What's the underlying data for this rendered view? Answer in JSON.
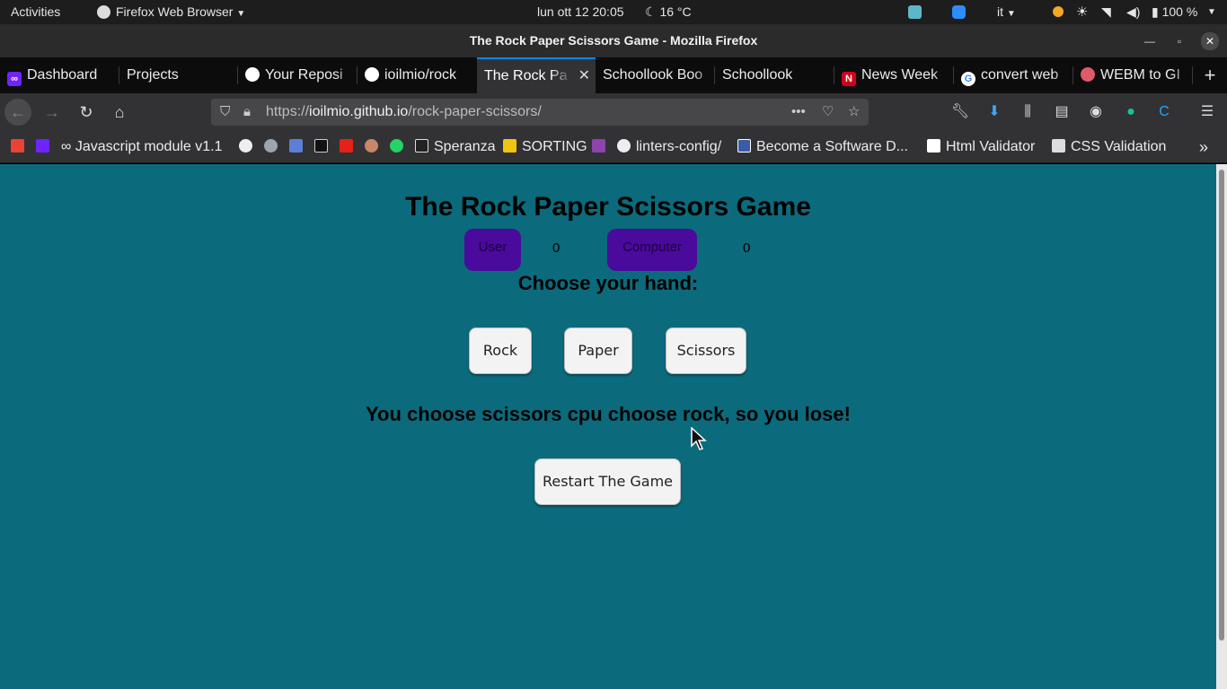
{
  "topbar": {
    "activities": "Activities",
    "app_name": "Firefox Web Browser",
    "datetime": "lun ott 12  20:05",
    "weather": "16 °C",
    "keyboard_layout": "it",
    "battery": "100 %"
  },
  "window": {
    "title": "The Rock Paper Scissors Game - Mozilla Firefox"
  },
  "tabs": [
    {
      "label": "Dashboard",
      "icon": "microverse-icon"
    },
    {
      "label": "Projects",
      "icon": ""
    },
    {
      "label": "Your Reposi",
      "icon": "github-icon"
    },
    {
      "label": "ioilmio/rock",
      "icon": "github-icon"
    },
    {
      "label": "The Rock Pa",
      "icon": "",
      "active": true
    },
    {
      "label": "Schoollook Boo",
      "icon": ""
    },
    {
      "label": "Schoollook",
      "icon": ""
    },
    {
      "label": "News Week",
      "icon": "news-icon"
    },
    {
      "label": "convert web",
      "icon": "google-icon"
    },
    {
      "label": "WEBM to GI",
      "icon": "cloud-icon"
    }
  ],
  "navbar": {
    "url_scheme": "https://",
    "url_host": "ioilmio.github.io",
    "url_path": "/rock-paper-scissors/"
  },
  "bookmarks": [
    {
      "label": "Javascript module v1.1"
    },
    {
      "label": "Speranza"
    },
    {
      "label": "SORTING"
    },
    {
      "label": "linters-config/"
    },
    {
      "label": "Become a Software D..."
    },
    {
      "label": "Html Validator"
    },
    {
      "label": "CSS Validation"
    }
  ],
  "game": {
    "title": "The Rock Paper Scissors Game",
    "user_label": "User",
    "user_score": "0",
    "computer_label": "Computer",
    "computer_score": "0",
    "choose_label": "Choose your hand:",
    "buttons": {
      "rock": "Rock",
      "paper": "Paper",
      "scissors": "Scissors"
    },
    "result": "You choose scissors cpu choose rock, so you lose!",
    "restart": "Restart The Game"
  },
  "colors": {
    "page_background": "#0b6b7c",
    "score_badge": "#4a0a9c",
    "active_tab_accent": "#0a84ff"
  }
}
